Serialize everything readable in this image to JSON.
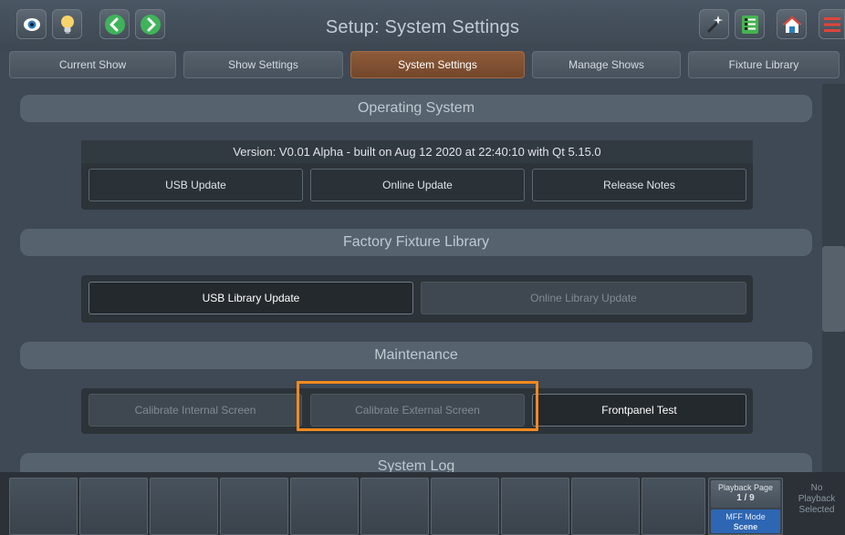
{
  "header": {
    "title": "Setup: System Settings",
    "left_buttons": [
      "eye-icon",
      "lightbulb-icon",
      "chevron-left-icon",
      "chevron-right-icon"
    ],
    "right_buttons": [
      "magic-wand-icon",
      "notes-icon",
      "home-icon",
      "menu-icon"
    ]
  },
  "tabs": [
    {
      "label": "Current Show"
    },
    {
      "label": "Show Settings"
    },
    {
      "label": "System Settings",
      "active": true
    },
    {
      "label": "Manage Shows"
    },
    {
      "label": "Fixture Library"
    }
  ],
  "sections": {
    "operating_system": {
      "title": "Operating System",
      "version": "Version: V0.01 Alpha - built on Aug 12 2020 at 22:40:10 with Qt 5.15.0",
      "buttons": [
        "USB Update",
        "Online Update",
        "Release Notes"
      ]
    },
    "factory_fixture_library": {
      "title": "Factory Fixture Library",
      "buttons": [
        "USB Library Update",
        "Online Library Update"
      ]
    },
    "maintenance": {
      "title": "Maintenance",
      "buttons": [
        "Calibrate Internal Screen",
        "Calibrate External Screen",
        "Frontpanel Test"
      ]
    },
    "system_log": {
      "title": "System Log"
    }
  },
  "bottom": {
    "playback_page_label": "Playback Page",
    "playback_page_value": "1 / 9",
    "mff_mode_label": "MFF Mode",
    "mff_mode_value": "Scene",
    "no_playback": [
      "No",
      "Playback",
      "Selected"
    ]
  },
  "colors": {
    "accent_active_tab": "#8d5b3a",
    "highlight_box": "#f28a1d",
    "mff_mode": "#2d66b3"
  }
}
